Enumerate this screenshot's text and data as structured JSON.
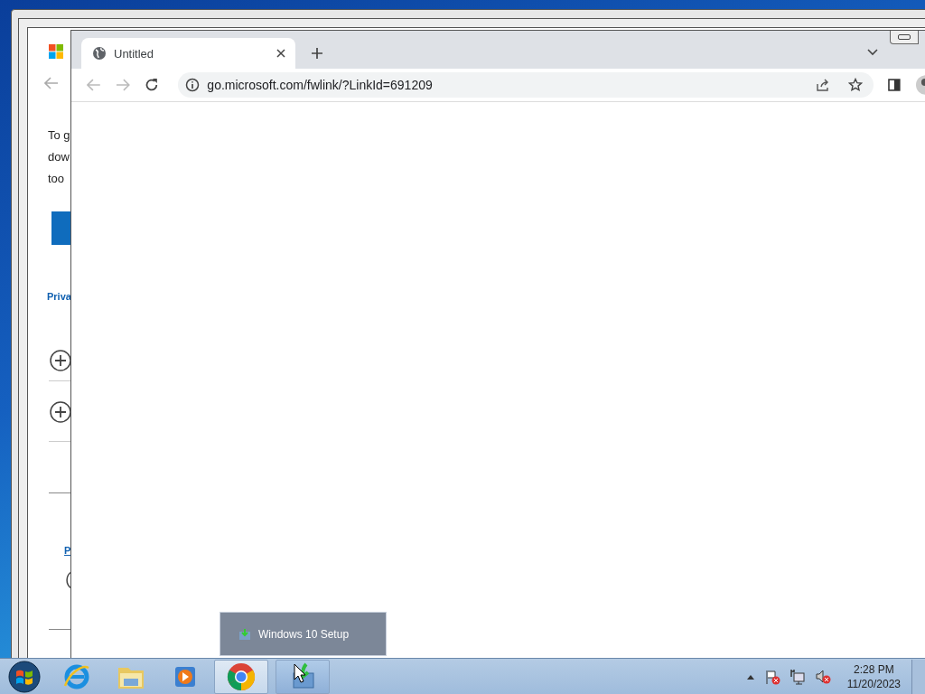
{
  "background_page": {
    "text_lines": [
      "To g",
      "dow",
      "too"
    ],
    "links": [
      "Priva",
      "P"
    ]
  },
  "browser": {
    "tabs": [
      {
        "title": "Untitled",
        "selected": true
      }
    ],
    "address": "go.microsoft.com/fwlink/?LinkId=691209"
  },
  "taskbar": {
    "apps": [
      {
        "kind": "ie",
        "running": false
      },
      {
        "kind": "explorer",
        "running": false
      },
      {
        "kind": "media",
        "running": false
      },
      {
        "kind": "chrome",
        "running": true
      },
      {
        "kind": "setup",
        "running": true
      }
    ],
    "preview": {
      "title": "Windows 10 Setup"
    },
    "clock": {
      "time": "2:28 PM",
      "date": "11/20/2023"
    }
  }
}
